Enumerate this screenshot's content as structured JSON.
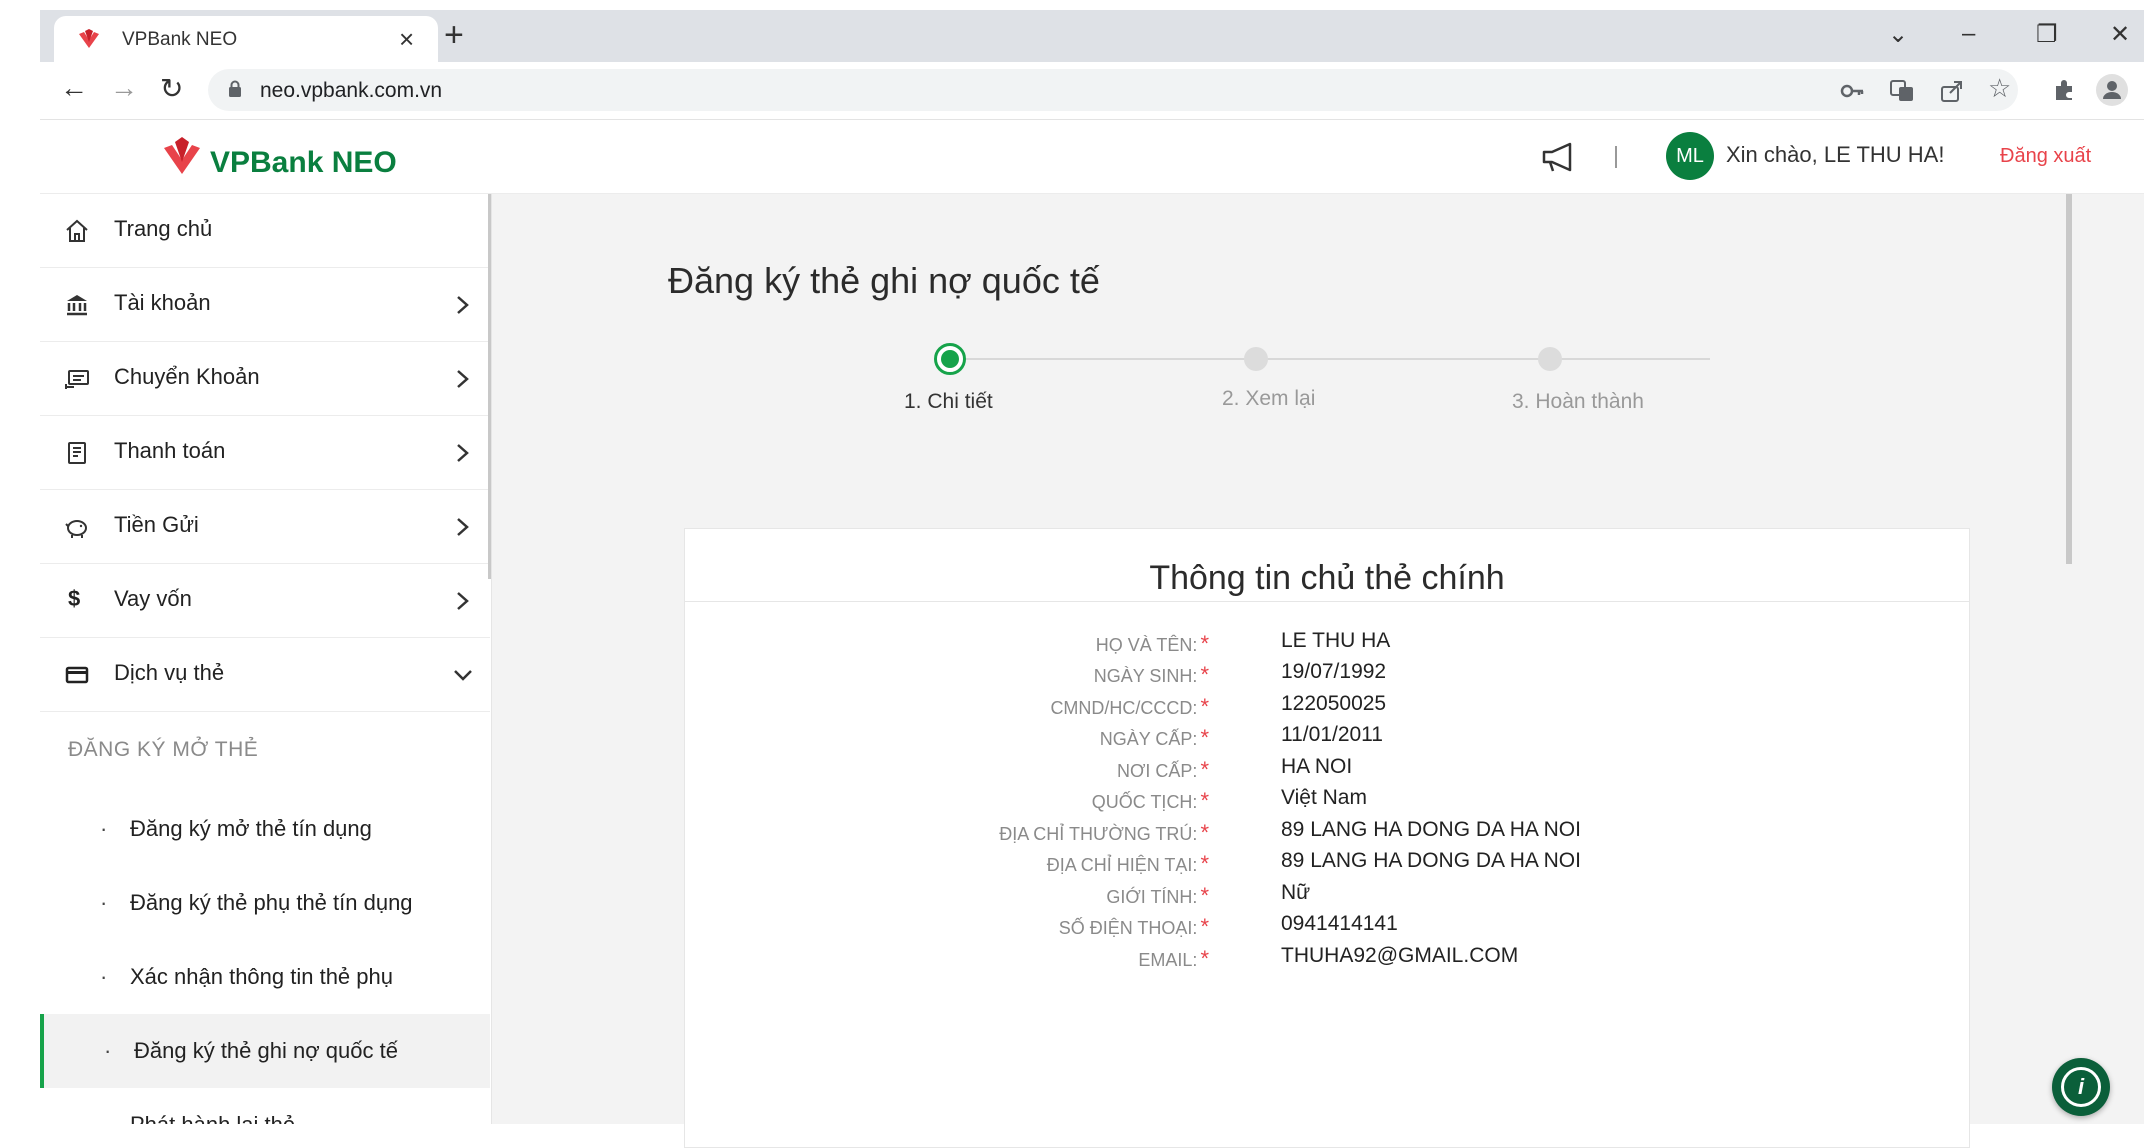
{
  "browser": {
    "tab_title": "VPBank NEO",
    "url": "neo.vpbank.com.vn"
  },
  "header": {
    "logo_text": "VPBank NEO",
    "avatar_initials": "ML",
    "greeting": "Xin chào, LE THU HA!",
    "logout": "Đăng xuất"
  },
  "sidebar": {
    "items": [
      {
        "label": "Trang chủ",
        "icon": "home-icon"
      },
      {
        "label": "Tài khoản",
        "icon": "bank-icon"
      },
      {
        "label": "Chuyển Khoản",
        "icon": "transfer-icon"
      },
      {
        "label": "Thanh toán",
        "icon": "bill-icon"
      },
      {
        "label": "Tiền Gửi",
        "icon": "piggy-bank-icon"
      },
      {
        "label": "Vay vốn",
        "icon": "dollar-icon"
      },
      {
        "label": "Dịch vụ thẻ",
        "icon": "card-icon"
      }
    ],
    "section_label": "ĐĂNG KÝ MỞ THẺ",
    "sub_items": [
      {
        "label": "Đăng ký mở thẻ tín dụng"
      },
      {
        "label": "Đăng ký thẻ phụ thẻ tín dụng"
      },
      {
        "label": "Xác nhận thông tin thẻ phụ"
      },
      {
        "label": "Đăng ký thẻ ghi nợ quốc tế",
        "active": true
      },
      {
        "label": "Phát hành lại thẻ"
      }
    ]
  },
  "main": {
    "page_title": "Đăng ký thẻ ghi nợ quốc tế",
    "steps": [
      {
        "label": "1. Chi tiết",
        "active": true
      },
      {
        "label": "2. Xem lại",
        "active": false
      },
      {
        "label": "3. Hoàn thành",
        "active": false
      }
    ],
    "card_title": "Thông tin chủ thẻ chính",
    "fields": [
      {
        "label": "HỌ VÀ TÊN:",
        "value": "LE THU HA"
      },
      {
        "label": "NGÀY SINH:",
        "value": "19/07/1992"
      },
      {
        "label": "CMND/HC/CCCD:",
        "value": "122050025"
      },
      {
        "label": "NGÀY CẤP:",
        "value": "11/01/2011"
      },
      {
        "label": "NƠI CẤP:",
        "value": "HA NOI"
      },
      {
        "label": "QUỐC TỊCH:",
        "value": "Việt Nam"
      },
      {
        "label": "ĐỊA CHỈ THƯỜNG TRÚ:",
        "value": "89 LANG HA DONG DA HA NOI"
      },
      {
        "label": "ĐỊA CHỈ HIỆN TẠI:",
        "value": "89 LANG HA DONG DA HA NOI"
      },
      {
        "label": "GIỚI TÍNH:",
        "value": "Nữ"
      },
      {
        "label": "SỐ ĐIỆN THOẠI:",
        "value": "0941414141"
      },
      {
        "label": "EMAIL:",
        "value": "THUHA92@GMAIL.COM"
      }
    ],
    "required_mark": "*"
  },
  "colors": {
    "brand_green": "#0a7f3f",
    "active_green": "#16a34a",
    "logout_red": "#e8434a"
  }
}
